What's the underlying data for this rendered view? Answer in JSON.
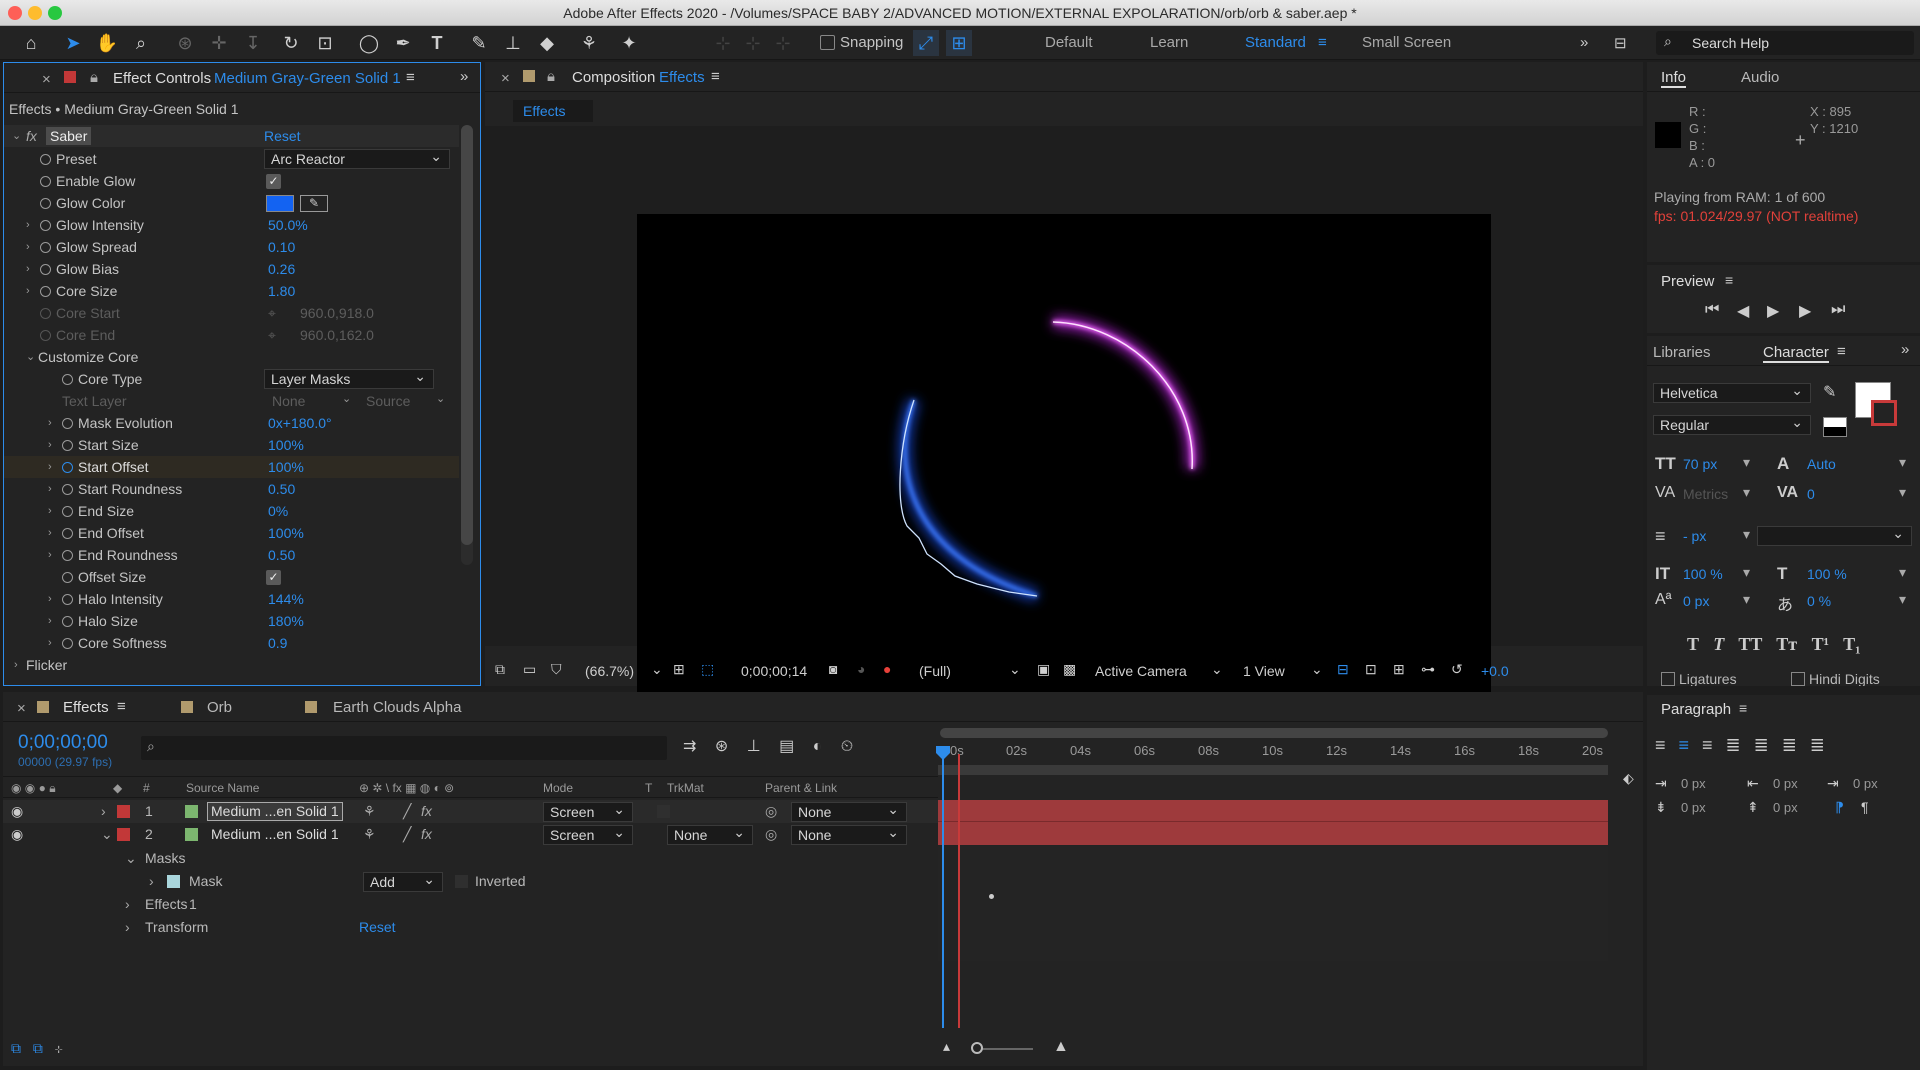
{
  "window": {
    "title": "Adobe After Effects 2020 - /Volumes/SPACE BABY 2/ADVANCED MOTION/EXTERNAL EXPOLARATION/orb/orb & saber.aep *"
  },
  "toolbar": {
    "snapping": "Snapping",
    "workspaces": [
      "Default",
      "Learn",
      "Standard",
      "Small Screen"
    ],
    "search": "Search Help"
  },
  "effect_controls": {
    "tab": "Effect Controls",
    "layer_name": "Medium Gray-Green Solid 1",
    "breadcrumb": "Effects • Medium Gray-Green Solid 1",
    "effect_name": "Saber",
    "reset": "Reset",
    "props": [
      {
        "label": "Preset",
        "value": "Arc Reactor"
      },
      {
        "label": "Enable Glow"
      },
      {
        "label": "Glow Color"
      },
      {
        "label": "Glow Intensity",
        "value": "50.0%"
      },
      {
        "label": "Glow Spread",
        "value": "0.10"
      },
      {
        "label": "Glow Bias",
        "value": "0.26"
      },
      {
        "label": "Core Size",
        "value": "1.80"
      },
      {
        "label": "Core Start",
        "value": "960.0,918.0"
      },
      {
        "label": "Core End",
        "value": "960.0,162.0"
      },
      {
        "label": "Customize Core"
      },
      {
        "label": "Core Type",
        "value": "Layer Masks"
      },
      {
        "label": "Text Layer",
        "value": "None",
        "value2": "Source"
      },
      {
        "label": "Mask Evolution",
        "value": "0x+180.0°"
      },
      {
        "label": "Start Size",
        "value": "100%"
      },
      {
        "label": "Start Offset",
        "value": "100%"
      },
      {
        "label": "Start Roundness",
        "value": "0.50"
      },
      {
        "label": "End Size",
        "value": "0%"
      },
      {
        "label": "End Offset",
        "value": "100%"
      },
      {
        "label": "End Roundness",
        "value": "0.50"
      },
      {
        "label": "Offset Size"
      },
      {
        "label": "Halo Intensity",
        "value": "144%"
      },
      {
        "label": "Halo Size",
        "value": "180%"
      },
      {
        "label": "Core Softness",
        "value": "0.9"
      },
      {
        "label": "Flicker"
      }
    ]
  },
  "composition": {
    "tab": "Composition",
    "comp_name": "Effects",
    "sub_tab": "Effects",
    "footer": {
      "zoom": "(66.7%)",
      "timecode": "0;00;00;14",
      "resolution": "(Full)",
      "camera": "Active Camera",
      "views": "1 View",
      "exposure": "+0.0"
    }
  },
  "info": {
    "tabs": [
      "Info",
      "Audio"
    ],
    "r": "R :",
    "g": "G :",
    "b": "B :",
    "a": "A :  0",
    "x": "X : 895",
    "y": "Y : 1210",
    "ram": "Playing from RAM: 1 of 600",
    "fps": "fps: 01.024/29.97 (NOT realtime)"
  },
  "preview": {
    "title": "Preview"
  },
  "character": {
    "tabs": [
      "Libraries",
      "Character"
    ],
    "font": "Helvetica",
    "style": "Regular",
    "size": "70 px",
    "leading": "Auto",
    "kerning": "Metrics",
    "tracking": "0",
    "stroke": "- px",
    "vscale": "100 %",
    "hscale": "100 %",
    "baseline": "0 px",
    "tsume": "0 %",
    "ligatures": "Ligatures",
    "hindi": "Hindi Digits"
  },
  "paragraph": {
    "title": "Paragraph",
    "indent1": "0 px",
    "indent2": "0 px",
    "indent3": "0 px",
    "space1": "0 px",
    "space2": "0 px"
  },
  "timeline": {
    "tabs": [
      "Effects",
      "Orb",
      "Earth Clouds Alpha"
    ],
    "timecode": "0;00;00;00",
    "frames": "00000 (29.97 fps)",
    "columns": {
      "num": "#",
      "source": "Source Name",
      "mode": "Mode",
      "t": "T",
      "trkmat": "TrkMat",
      "parent": "Parent & Link"
    },
    "layers": [
      {
        "num": "1",
        "name": "Medium ...en Solid 1",
        "mode": "Screen",
        "trkmat": "",
        "parent": "None"
      },
      {
        "num": "2",
        "name": "Medium ...en Solid 1",
        "mode": "Screen",
        "trkmat": "None",
        "parent": "None"
      }
    ],
    "masks": "Masks",
    "mask1": "Mask 1",
    "mask_mode": "Add",
    "inverted": "Inverted",
    "effects": "Effects",
    "transform": "Transform",
    "reset": "Reset",
    "ruler": [
      "0s",
      "02s",
      "04s",
      "06s",
      "08s",
      "10s",
      "12s",
      "14s",
      "16s",
      "18s",
      "20s"
    ]
  }
}
